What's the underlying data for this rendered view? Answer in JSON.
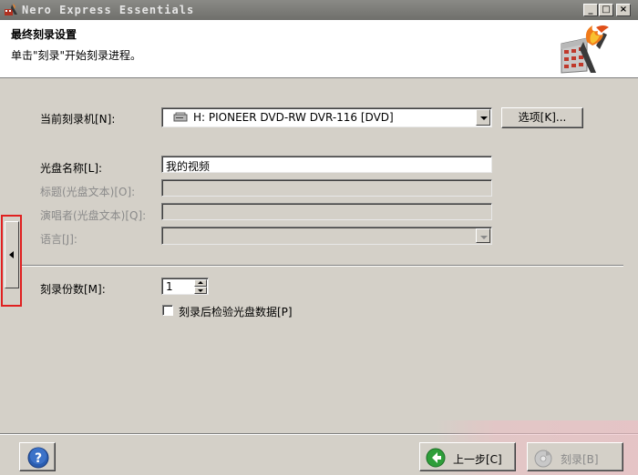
{
  "window": {
    "title": "Nero Express Essentials",
    "min_glyph": "_",
    "max_glyph": "□",
    "close_glyph": "×"
  },
  "header": {
    "title": "最终刻录设置",
    "subtitle": "单击\"刻录\"开始刻录进程。",
    "logo_icon": "nero-flame-logo-icon"
  },
  "recorder": {
    "label": "当前刻录机[N]:",
    "value": "H: PIONEER DVD-RW  DVR-116   [DVD]",
    "device_icon": "drive-icon",
    "options_button": "选项[K]..."
  },
  "disc": {
    "name_label": "光盘名称[L]:",
    "name_value": "我的视频",
    "title_label": "标题(光盘文本)[O]:",
    "artist_label": "演唱者(光盘文本)[Q]:",
    "language_label": "语言[J]:"
  },
  "copies": {
    "label": "刻录份数[M]:",
    "value": "1"
  },
  "verify": {
    "label": "刻录后检验光盘数据[P]",
    "checked": false
  },
  "footer": {
    "help_glyph": "?",
    "back_label": "上一步[C]",
    "burn_label": "刻录[B]"
  },
  "colors": {
    "face": "#d4d0c8",
    "highlight": "#e02020",
    "back_arrow": "#2e9e3a"
  }
}
